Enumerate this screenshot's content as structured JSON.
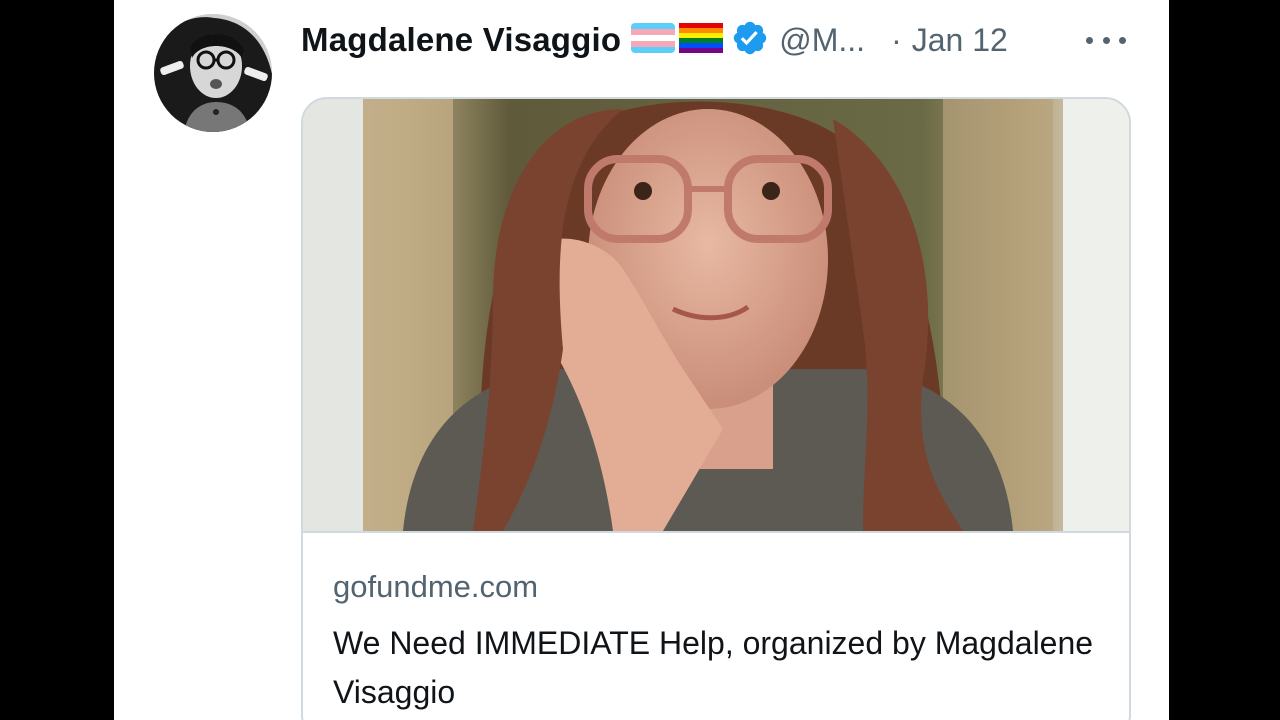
{
  "tweet": {
    "author_name": "Magdalene Visaggio",
    "handle": "@M...",
    "separator": "·",
    "date": "Jan 12",
    "flags": [
      "transgender-flag-icon",
      "rainbow-flag-icon"
    ],
    "verified_icon": "verified-badge-icon",
    "more_icon": "more-options-icon"
  },
  "link_card": {
    "domain": "gofundme.com",
    "title": "We Need IMMEDIATE Help, organized by Magdalene Visaggio"
  },
  "colors": {
    "text_primary": "#0f1419",
    "text_secondary": "#536471",
    "verified_blue": "#1d9bf0",
    "border": "#cfd9de"
  }
}
